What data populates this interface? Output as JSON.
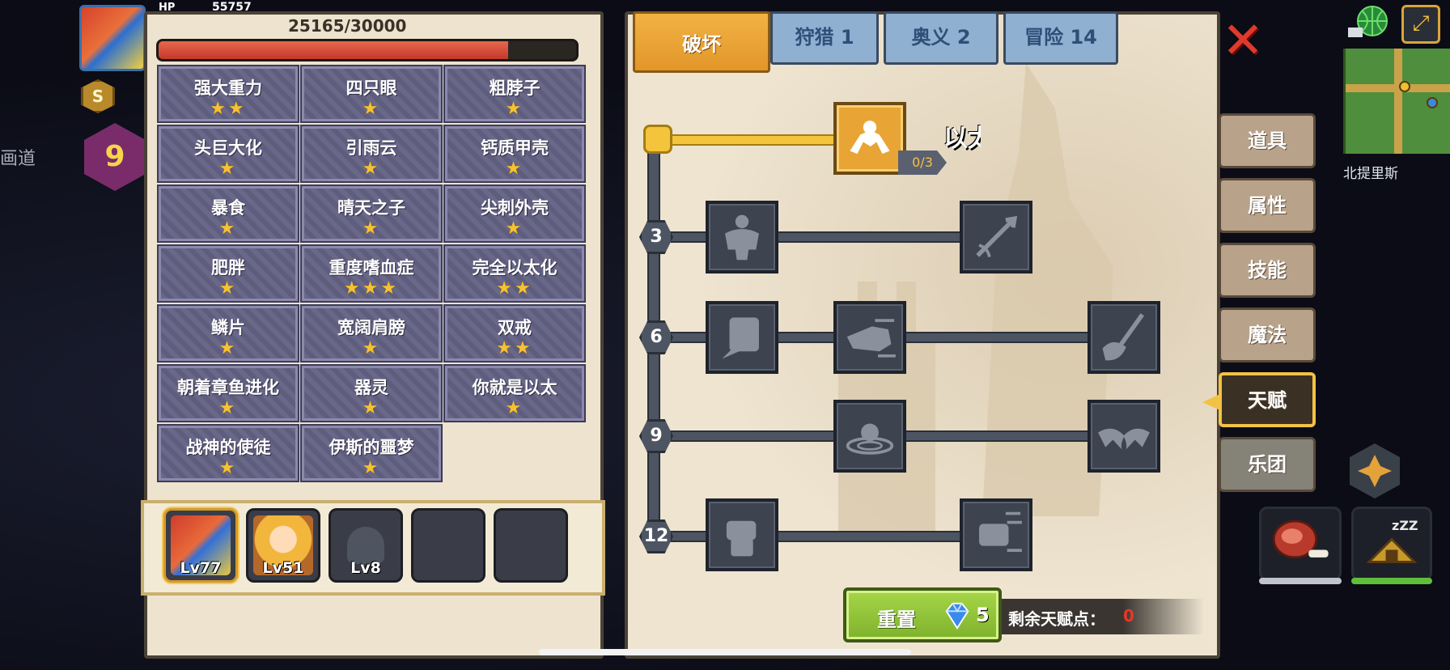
{
  "hud": {
    "hp_label": "HP",
    "hp_value": "55757",
    "gold_symbol": "S",
    "level": "9",
    "left_map_text": "画道",
    "town_name": "北提里斯"
  },
  "status_panel": {
    "hp_count": "25165/30000",
    "hp_ratio": 0.838,
    "traits": [
      {
        "name": "强大重力",
        "stars": "★★"
      },
      {
        "name": "四只眼",
        "stars": "★"
      },
      {
        "name": "粗脖子",
        "stars": "★"
      },
      {
        "name": "头巨大化",
        "stars": "★"
      },
      {
        "name": "引雨云",
        "stars": "★"
      },
      {
        "name": "钙质甲壳",
        "stars": "★"
      },
      {
        "name": "暴食",
        "stars": "★"
      },
      {
        "name": "晴天之子",
        "stars": "★"
      },
      {
        "name": "尖刺外壳",
        "stars": "★"
      },
      {
        "name": "肥胖",
        "stars": "★"
      },
      {
        "name": "重度嗜血症",
        "stars": "★★★"
      },
      {
        "name": "完全以太化",
        "stars": "★★"
      },
      {
        "name": "鳞片",
        "stars": "★"
      },
      {
        "name": "宽阔肩膀",
        "stars": "★"
      },
      {
        "name": "双戒",
        "stars": "★★"
      },
      {
        "name": "朝着章鱼进化",
        "stars": "★"
      },
      {
        "name": "器灵",
        "stars": "★"
      },
      {
        "name": "你就是以太",
        "stars": "★"
      },
      {
        "name": "战神的使徒",
        "stars": "★"
      },
      {
        "name": "伊斯的噩梦",
        "stars": "★"
      }
    ]
  },
  "party": [
    {
      "level": "Lv77"
    },
    {
      "level": "Lv51"
    },
    {
      "level": "Lv8"
    },
    {
      "level": ""
    },
    {
      "level": ""
    }
  ],
  "talent_tabs": [
    {
      "label": "破坏",
      "active": true
    },
    {
      "label": "狩猎 1",
      "active": false
    },
    {
      "label": "奥义 2",
      "active": false
    },
    {
      "label": "冒险 14",
      "active": false
    }
  ],
  "talent_tree": {
    "first_skill_count": "0/3",
    "first_skill_label": "以太",
    "tier_levels": [
      "3",
      "6",
      "9",
      "12"
    ]
  },
  "footer": {
    "reset_label": "重置",
    "reset_cost": "5",
    "points_label": "剩余天赋点：",
    "points_value": "0"
  },
  "side_menu": [
    {
      "label": "道具"
    },
    {
      "label": "属性"
    },
    {
      "label": "技能"
    },
    {
      "label": "魔法"
    },
    {
      "label": "天赋"
    },
    {
      "label": "乐团"
    }
  ],
  "colors": {
    "accent_gold": "#f2c244",
    "tab_active": "#e8a434",
    "tab_inactive": "#8fb0d0",
    "reset_green": "#8bc238",
    "points_red": "#e53828",
    "hp_red": "#d44a38"
  }
}
